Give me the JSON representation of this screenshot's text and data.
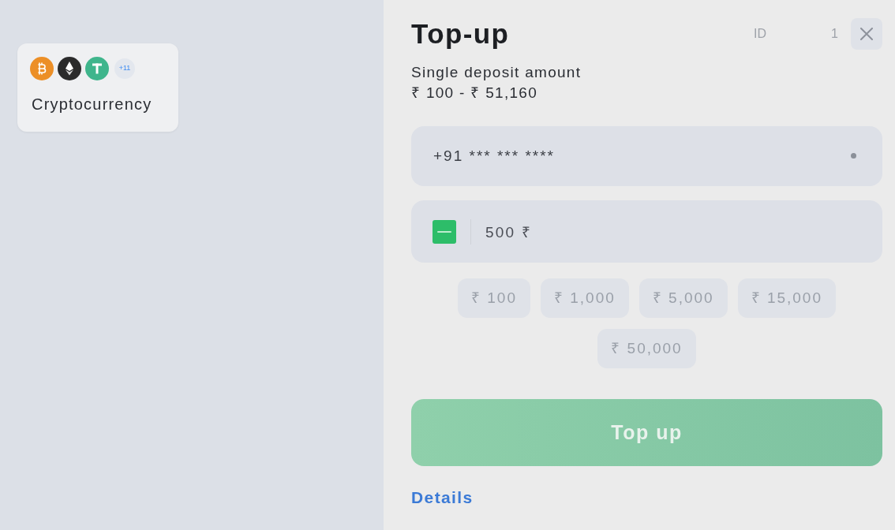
{
  "payment_methods": [
    {
      "label": "Cryptocurrency",
      "coins": [
        {
          "kind": "bitcoin"
        },
        {
          "kind": "ethereum"
        },
        {
          "kind": "tether"
        }
      ],
      "more_count": "+11"
    }
  ],
  "topup": {
    "title": "Top-up",
    "id_label": "ID",
    "id_value": "1",
    "limits_label": "Single deposit amount",
    "limits_range": "₹ 100 - ₹ 51,160",
    "phone_field": {
      "value": "+91 *** *** ****"
    },
    "amount_field": {
      "value": "500 ₹"
    },
    "quick_amounts": [
      "₹ 100",
      "₹ 1,000",
      "₹ 5,000",
      "₹ 15,000",
      "₹ 50,000"
    ],
    "submit": {
      "label": "Top up",
      "disabled": true
    },
    "details_link": "Details"
  }
}
